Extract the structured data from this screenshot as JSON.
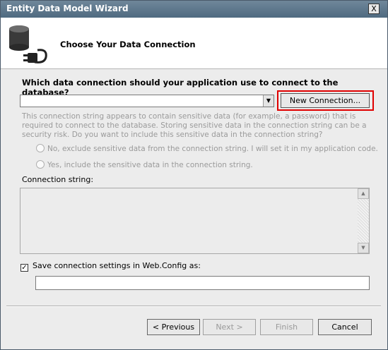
{
  "window": {
    "title": "Entity Data Model Wizard",
    "close_glyph": "X"
  },
  "header": {
    "title": "Choose Your Data Connection",
    "icon": "database-plug-icon"
  },
  "connection": {
    "question": "Which data connection should your application use to connect to the database?",
    "dropdown_value": "",
    "new_connection_label": "New Connection...",
    "highlight_color": "#e00000",
    "sensitive_text": "This connection string appears to contain sensitive data (for example, a password) that is required to connect to the database. Storing sensitive data in the connection string can be a security risk. Do you want to include this sensitive data in the connection string?",
    "radio_exclude": "No, exclude sensitive data from the connection string. I will set it in my application code.",
    "radio_include": "Yes, include the sensitive data in the connection string.",
    "connection_string_label": "Connection string:",
    "connection_string_value": ""
  },
  "config": {
    "save_checked": true,
    "save_label": "Save connection settings in Web.Config as:",
    "name_value": ""
  },
  "buttons": {
    "previous": "< Previous",
    "next": "Next >",
    "finish": "Finish",
    "cancel": "Cancel"
  }
}
